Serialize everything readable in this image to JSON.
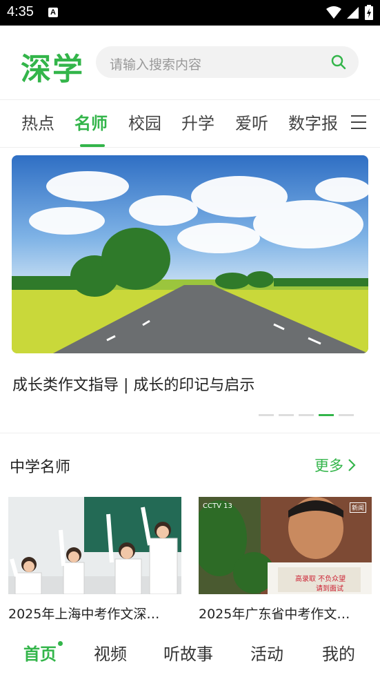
{
  "status": {
    "time": "4:35",
    "notif_icon": "A"
  },
  "header": {
    "logo": "深学",
    "search_placeholder": "请输入搜索内容"
  },
  "tabs": [
    "热点",
    "名师",
    "校园",
    "升学",
    "爱听",
    "数字报"
  ],
  "active_tab": "名师",
  "banner": {
    "caption": "成长类作文指导 | 成长的印记与启示",
    "slide_count": 5,
    "active_slide": 4
  },
  "section": {
    "title": "中学名师",
    "more_label": "更多"
  },
  "cards": [
    {
      "title": "2025年上海中考作文深…"
    },
    {
      "title": "2025年广东省中考作文…"
    }
  ],
  "card2_overlay": {
    "channel": "CCTV 13",
    "stamp": "新闻",
    "text1": "高录取 不负众望",
    "text2": "请到面试"
  },
  "bottom_nav": [
    "首页",
    "视频",
    "听故事",
    "活动",
    "我的"
  ],
  "colors": {
    "accent": "#33b54a"
  }
}
